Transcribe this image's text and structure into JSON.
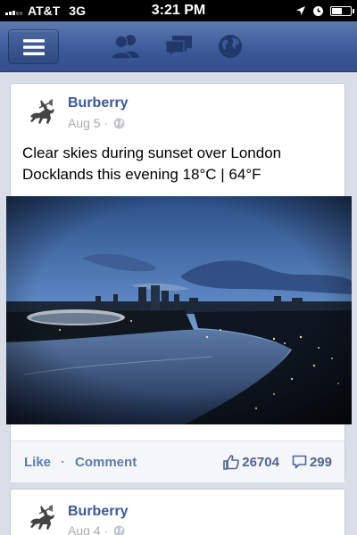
{
  "status_bar": {
    "carrier": "AT&T",
    "network": "3G",
    "time": "3:21 PM",
    "battery_level": 0.6
  },
  "nav": {
    "menu_icon": "hamburger-icon",
    "icons": [
      "friend-requests-icon",
      "messages-icon",
      "notifications-globe-icon"
    ]
  },
  "posts": [
    {
      "author": "Burberry",
      "date": "Aug 5",
      "separator": "·",
      "privacy_icon": "globe-icon",
      "text": "Clear skies during sunset over London Docklands this evening 18°C | 64°F",
      "actions": {
        "like": "Like",
        "dot": "·",
        "comment": "Comment"
      },
      "likes": "26704",
      "comments": "299"
    },
    {
      "author": "Burberry",
      "date": "Aug 4",
      "separator": "·",
      "privacy_icon": "globe-icon"
    }
  ],
  "colors": {
    "brand_blue": "#3b5998",
    "feed_background": "#d8dde8",
    "link_blue": "#5b7bb0"
  }
}
